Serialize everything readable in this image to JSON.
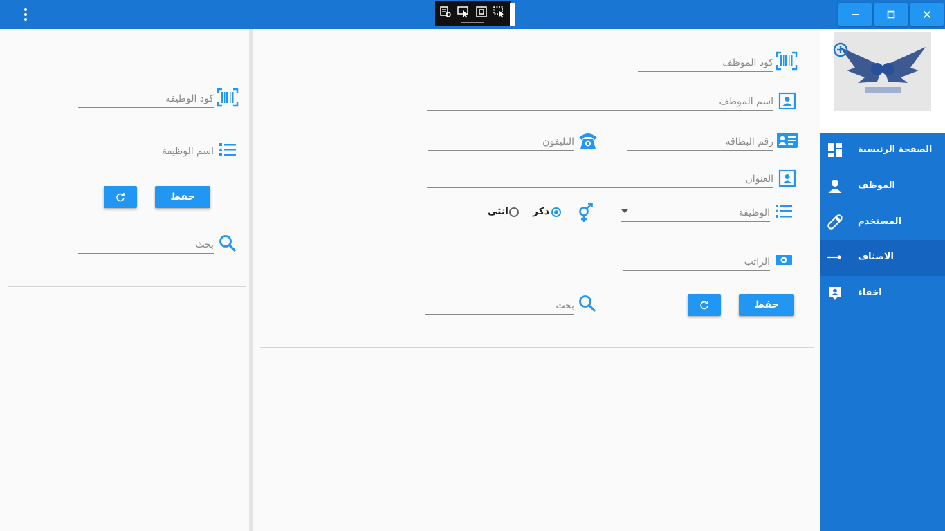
{
  "titlebar": {
    "menu_icon": "more-vert-icon",
    "debug_tools": [
      "select-element-icon",
      "pointer-icon",
      "layout-bounds-icon",
      "hot-reload-icon"
    ],
    "window_buttons": [
      "minimize-icon",
      "maximize-icon",
      "close-icon"
    ]
  },
  "left_panel": {
    "job_code_placeholder": "كود الوظيفة",
    "job_name_placeholder": "اسم الوظيفة",
    "save_label": "حفظ",
    "search_placeholder": "بحث"
  },
  "main_panel": {
    "employee_code_placeholder": "كود الموظف",
    "employee_name_placeholder": "اسم الموظف",
    "card_number_placeholder": "رقم البطاقة",
    "phone_placeholder": "التليفون",
    "address_placeholder": "العنوان",
    "job_placeholder": "الوظيفة",
    "gender_options": [
      "ذكر",
      "انثى"
    ],
    "selected_gender": "ذكر",
    "salary_placeholder": "الراتب",
    "save_label": "حفظ",
    "search_placeholder": "بحث"
  },
  "sidebar": {
    "items": [
      {
        "label": "الصفحة الرئيسية",
        "icon": "dashboard-icon"
      },
      {
        "label": "الموظف",
        "icon": "person-icon"
      },
      {
        "label": "المستخدم",
        "icon": "pill-icon"
      },
      {
        "label": "الاصناف",
        "icon": "slider-icon"
      },
      {
        "label": "اخفاء",
        "icon": "contact-icon"
      }
    ],
    "active_index": 3
  },
  "colors": {
    "primary": "#1976d2",
    "accent": "#2196f3",
    "active_nav": "#1565c0"
  }
}
